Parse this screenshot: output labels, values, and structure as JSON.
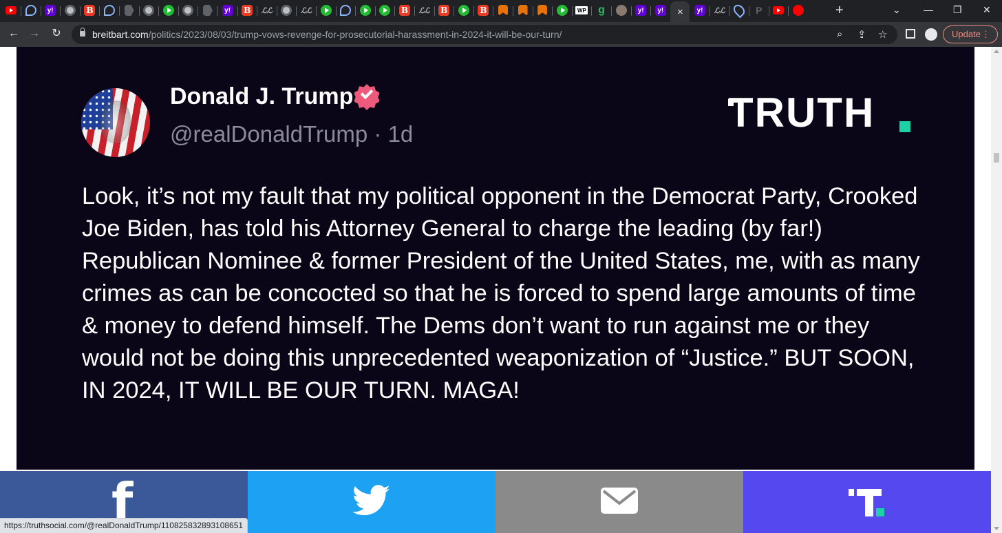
{
  "browser": {
    "tabs": [
      {
        "icon": "youtube-icon"
      },
      {
        "icon": "phoenix-icon"
      },
      {
        "icon": "yahoo-icon",
        "text": "y!"
      },
      {
        "icon": "globe-icon"
      },
      {
        "icon": "breitbart-icon",
        "text": "B"
      },
      {
        "icon": "phoenix-icon"
      },
      {
        "icon": "arrow-icon"
      },
      {
        "icon": "map-icon"
      },
      {
        "icon": "play-icon"
      },
      {
        "icon": "globe-icon"
      },
      {
        "icon": "arrow-icon"
      },
      {
        "icon": "yahoo-icon",
        "text": "y!"
      },
      {
        "icon": "breitbart-icon",
        "text": "B"
      },
      {
        "icon": "lili-icon",
        "text": "ℒℒ"
      },
      {
        "icon": "globe-icon"
      },
      {
        "icon": "lili-icon",
        "text": "ℒℒ"
      },
      {
        "icon": "play-icon"
      },
      {
        "icon": "phoenix-icon"
      },
      {
        "icon": "play-icon"
      },
      {
        "icon": "play-icon"
      },
      {
        "icon": "breitbart-icon",
        "text": "B"
      },
      {
        "icon": "lili-icon",
        "text": "ℒℒ"
      },
      {
        "icon": "breitbart-icon",
        "text": "B"
      },
      {
        "icon": "play-icon"
      },
      {
        "icon": "breitbart-icon",
        "text": "B"
      },
      {
        "icon": "bookmark-icon"
      },
      {
        "icon": "bookmark-icon"
      },
      {
        "icon": "bookmark-icon"
      },
      {
        "icon": "play-icon"
      },
      {
        "icon": "wp-icon",
        "text": "WP"
      },
      {
        "icon": "g-icon",
        "text": "g"
      },
      {
        "icon": "avatar-icon"
      },
      {
        "icon": "yahoo-icon",
        "text": "y!"
      },
      {
        "icon": "yahoo-icon",
        "text": "y!"
      },
      {
        "icon": "close-icon",
        "text": "×",
        "active": true
      },
      {
        "icon": "yahoo-icon",
        "text": "y!"
      },
      {
        "icon": "lili-icon",
        "text": "ℒℒ"
      },
      {
        "icon": "pin-icon"
      },
      {
        "icon": "p-icon",
        "text": "P"
      },
      {
        "icon": "youtube-icon"
      },
      {
        "icon": "mic-icon"
      }
    ],
    "new_tab_label": "+",
    "url_host": "breitbart.com",
    "url_path": "/politics/2023/08/03/trump-vows-revenge-for-prosecutorial-harassment-in-2024-it-will-be-our-turn/",
    "update_label": "Update",
    "update_menu_glyph": "⋮",
    "status_url": "https://truthsocial.com/@realDonaldTrump/110825832893108651"
  },
  "post": {
    "author_name": "Donald J. Trump",
    "handle": "@realDonaldTrump",
    "separator": "·",
    "age": "1d",
    "platform_logo": "TRUTH",
    "text": "Look, it’s not my fault that my political opponent in the Democrat Party, Crooked Joe Biden, has told his Attorney General to charge the leading (by far!) Republican Nominee & former President of the United States, me, with as many crimes as can be concocted so that he is forced to spend large amounts of time & money to defend himself. The Dems don’t want to run against me or they would not be doing this unprecedented weaponization of “Justice.” BUT SOON, IN 2024, IT WILL BE OUR TURN. MAGA!"
  },
  "share": {
    "facebook_glyph": "f",
    "buttons": [
      "facebook-icon",
      "twitter-icon",
      "email-icon",
      "truth-social-icon"
    ]
  },
  "colors": {
    "card_bg": "#0a0517",
    "verified": "#ee5a7c",
    "truth_accent": "#1bd1a5",
    "facebook": "#3b5998",
    "twitter": "#1da1f2",
    "email": "#8a8a8a",
    "truth_social": "#5448ee"
  }
}
